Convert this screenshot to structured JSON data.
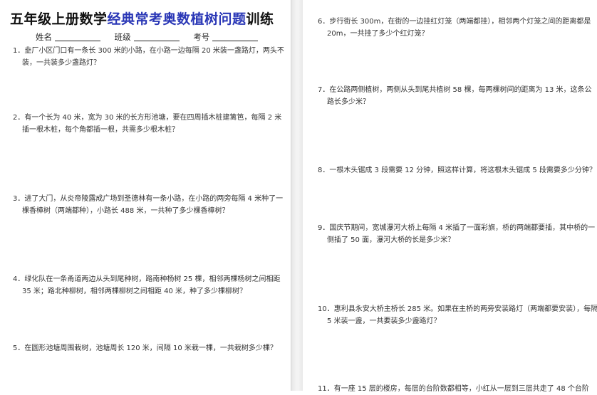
{
  "title": {
    "prefix": "五年级上册数学",
    "highlight": "经典常考奥数植树问题",
    "suffix": "训练"
  },
  "meta": {
    "name_label": "姓名",
    "class_label": "班级",
    "id_label": "考号"
  },
  "questions": [
    "1．韭厂小区门口有一条长 300 米的小路，在小路一边每隔 20 米装一盏路灯，两头不装，一共装多少盏路灯？",
    "2．有一个长为 40 米，宽为 30 米的长方形池塘，要在四周插木桩建篱笆，每隔 2 米插一根木桩，每个角都插一根，共需多少根木桩？",
    "3．进了大门，从炎帝陵露成广场到圣德林有一条小路，在小路的两旁每隔 4 米种了一棵香樟树（两端都种），小路长 488 米，一共种了多少棵香樟树？",
    "4．绿化队在一条甬道两边从头到尾种树，路南种杨树 25 棵，相邻两棵杨树之间相距 35 米；路北种柳树，相邻两棵柳树之间相距 40 米，种了多少棵柳树？",
    "5．在圆形池塘周围栽树，池塘周长 120 米，间隔 10 米栽一棵，一共栽树多少棵？",
    "6．步行街长 300m，在街的一边挂红灯笼（两端都挂），相邻两个灯笼之间的距离都是 20m，一共挂了多少个红灯笼？",
    "7．在公路两侧植树，两侧从头到尾共植树 58 棵，每两棵树间的距离为 13 米，这条公路长多少米？",
    "8．一根木头锯成 3 段需要 12 分钟，照这样计算，将这根木头锯成 5 段需要多少分钟？",
    "9．国庆节期间，宽城瀑河大桥上每隔 4 米插了一面彩旗，桥的两端都要插，其中桥的一侧插了 50 面，瀑河大桥的长是多少米？",
    "10．惠利县永安大桥主桥长 285 米。如果在主桥的两旁安装路灯（两端都要安装），每隔 5 米装一盏，一共要装多少盏路灯？",
    "11．有一座 15 层的楼房，每层的台阶数都相等，小红从一层到三层共走了 48 个台阶"
  ]
}
